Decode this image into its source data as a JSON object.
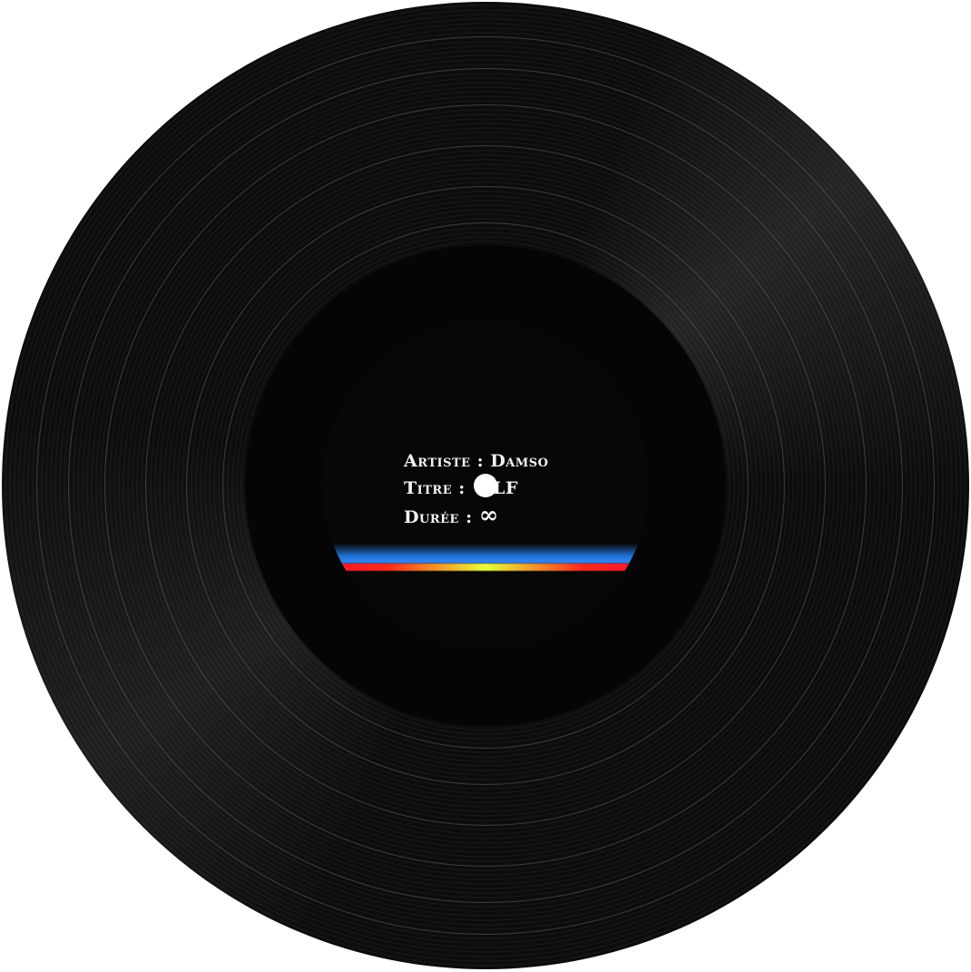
{
  "record": {
    "label_lines": [
      {
        "key": "Artiste",
        "value": "Damso"
      },
      {
        "key": "Titre",
        "value": "ALF"
      },
      {
        "key": "Durée",
        "value": "∞"
      }
    ],
    "separator": ":",
    "colors": {
      "vinyl": "#0b0b0b",
      "band_blue": "#1e6fd0",
      "band_red": "#ff1030",
      "band_yellow": "#e8ff3a"
    }
  }
}
